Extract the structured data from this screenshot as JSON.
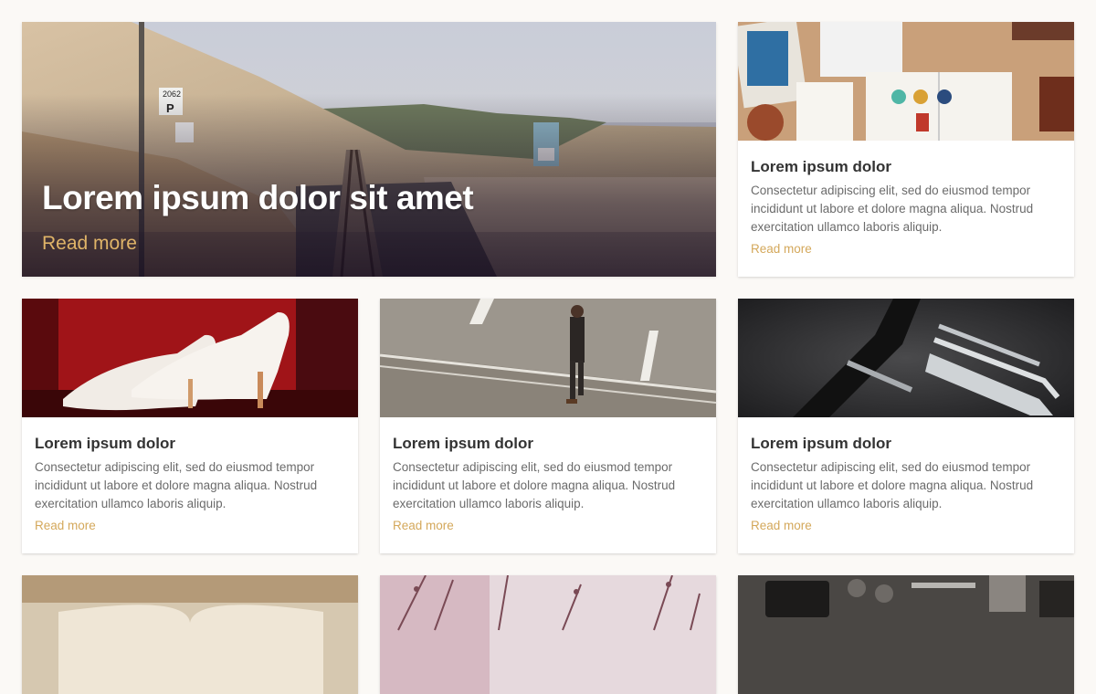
{
  "hero": {
    "title": "Lorem ipsum dolor sit amet",
    "read_more": "Read more",
    "sign_number": "2062",
    "sign_letter": "P"
  },
  "cards": [
    {
      "title": "Lorem ipsum dolor",
      "text": "Consectetur adipiscing elit, sed do eiusmod tempor incididunt ut labore et dolore magna aliqua. Nostrud exercitation ullamco laboris aliquip.",
      "read_more": "Read more",
      "image": "desk-flatlay"
    },
    {
      "title": "Lorem ipsum dolor",
      "text": "Consectetur adipiscing elit, sed do eiusmod tempor incididunt ut labore et dolore magna aliqua. Nostrud exercitation ullamco laboris aliquip.",
      "read_more": "Read more",
      "image": "white-heels"
    },
    {
      "title": "Lorem ipsum dolor",
      "text": "Consectetur adipiscing elit, sed do eiusmod tempor incididunt ut labore et dolore magna aliqua. Nostrud exercitation ullamco laboris aliquip.",
      "read_more": "Read more",
      "image": "man-crossing-road"
    },
    {
      "title": "Lorem ipsum dolor",
      "text": "Consectetur adipiscing elit, sed do eiusmod tempor incididunt ut labore et dolore magna aliqua. Nostrud exercitation ullamco laboris aliquip.",
      "read_more": "Read more",
      "image": "fork-closeup"
    },
    {
      "image": "open-book"
    },
    {
      "image": "pink-branches"
    },
    {
      "image": "travel-flatlay"
    }
  ],
  "colors": {
    "background": "#fbf9f6",
    "accent": "#d4a85b",
    "title": "#333333",
    "text": "#6b6b6b"
  }
}
